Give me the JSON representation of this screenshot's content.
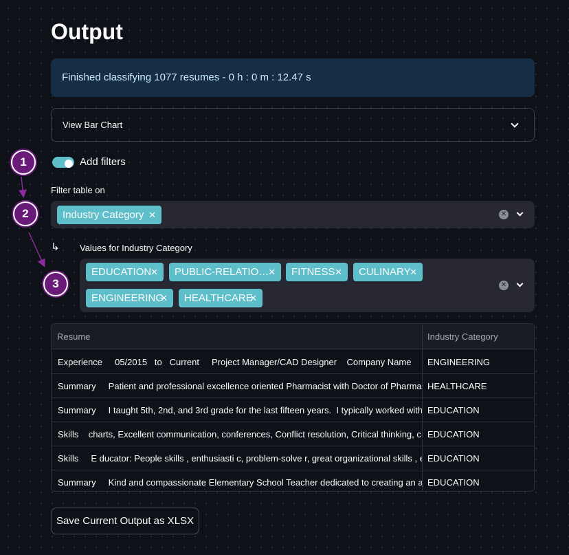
{
  "page": {
    "title": "Output"
  },
  "info": {
    "message": "Finished classifying 1077 resumes - 0 h : 0 m : 12.47 s"
  },
  "expander": {
    "label": "View Bar Chart"
  },
  "toggle": {
    "label": "Add filters",
    "checked": true
  },
  "filter_on": {
    "label": "Filter table on",
    "selected": [
      "Industry Category"
    ]
  },
  "values_filter": {
    "arrow": "↳",
    "label": "Values for Industry Category",
    "selected": [
      "EDUCATION",
      "PUBLIC-RELATIO…",
      "FITNESS",
      "CULINARY",
      "ENGINEERING",
      "HEALTHCARE"
    ]
  },
  "table": {
    "columns": [
      "Resume",
      "Industry Category"
    ],
    "rows": [
      [
        "Experience     05/2015   to   Current     Project Manager/CAD Designer    Company Name        City",
        "ENGINEERING"
      ],
      [
        "Summary     Patient and professional excellence oriented Pharmacist with Doctor of Pharmacy",
        "HEALTHCARE"
      ],
      [
        "Summary     I taught 5th, 2nd, and 3rd grade for the last fifteen years.  I typically worked with",
        "EDUCATION"
      ],
      [
        "Skills    charts, Excellent communication, conferences, Conflict resolution, Critical thinking, c",
        "EDUCATION"
      ],
      [
        "Skills     E ducator: People skills , enthusiasti c, problem-solve r, great organizational skills , e",
        "EDUCATION"
      ],
      [
        "Summary     Kind and compassionate Elementary School Teacher dedicated to creating an a",
        "EDUCATION"
      ]
    ]
  },
  "save_button": {
    "label": "Save Current Output as XLSX"
  },
  "annotations": [
    "1",
    "2",
    "3"
  ],
  "colors": {
    "background": "#0e1117",
    "tag": "#5ebfcb",
    "info_bg": "#172d43",
    "badge": "#6a1b7a"
  }
}
